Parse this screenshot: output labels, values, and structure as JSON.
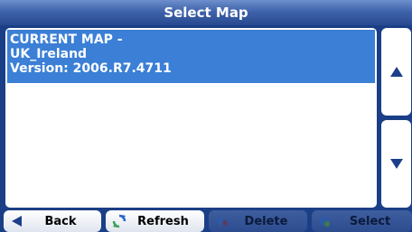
{
  "header": {
    "title": "Select Map"
  },
  "map_list": {
    "items": [
      {
        "selected": true,
        "lines": [
          "CURRENT MAP -",
          "UK_Ireland",
          "Version:  2006.R7.4711"
        ]
      }
    ]
  },
  "scroll": {
    "up_icon": "triangle-up-icon",
    "down_icon": "triangle-down-icon"
  },
  "toolbar": {
    "back_label": "Back",
    "refresh_label": "Refresh",
    "delete_label": "Delete",
    "select_label": "Select"
  },
  "colors": {
    "background": "#1b3f86",
    "selection": "#3b7fd6",
    "title_text": "#ffffff",
    "icon": "#1d3f8a"
  }
}
